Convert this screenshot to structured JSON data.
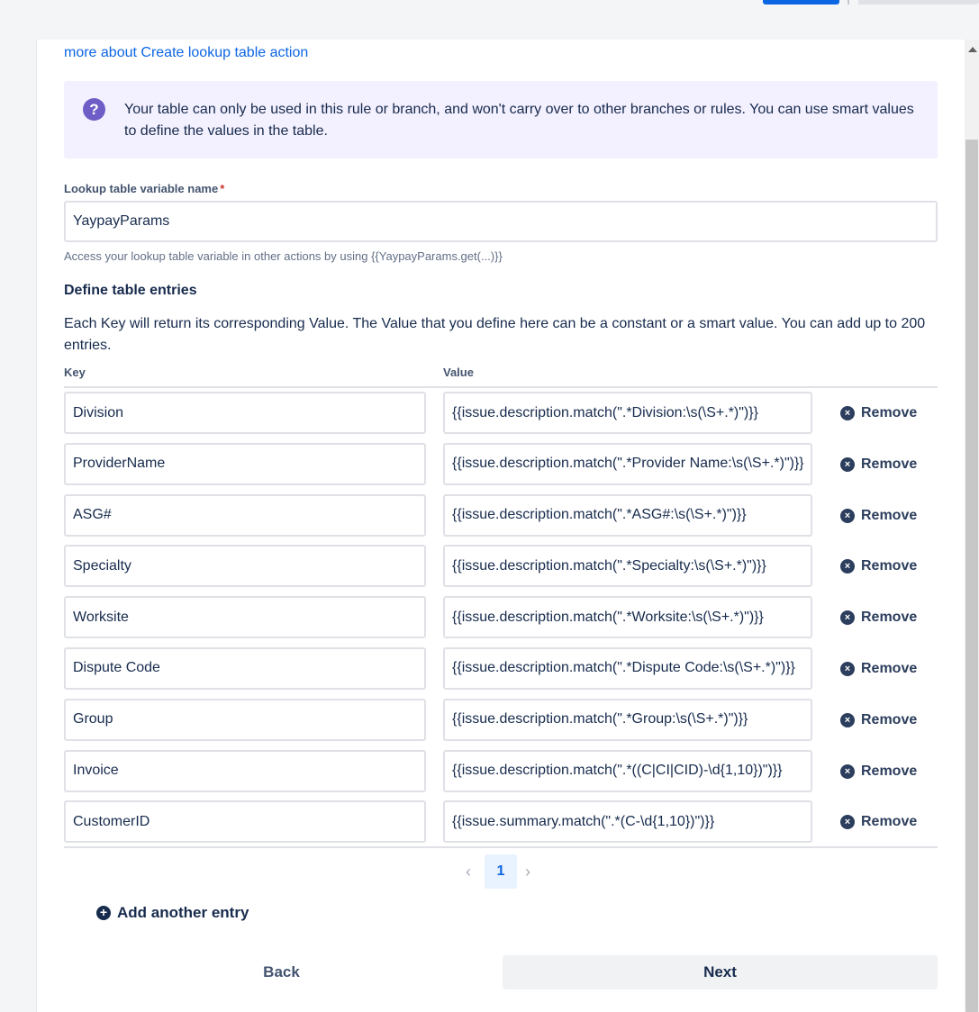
{
  "header": {
    "learn_more_link": "more about Create lookup table action"
  },
  "info_panel": {
    "icon": "question-icon",
    "icon_glyph": "?",
    "text": "Your table can only be used in this rule or branch, and won't carry over to other branches or rules. You can use smart values to define the values in the table."
  },
  "variable": {
    "label": "Lookup table variable name",
    "required_marker": "*",
    "value": "YaypayParams",
    "helper": "Access your lookup table variable in other actions by using {{YaypayParams.get(...)}}"
  },
  "entries_section": {
    "title": "Define table entries",
    "description": "Each Key will return its corresponding Value. The Value that you define here can be a constant or a smart value. You can add up to 200 entries.",
    "key_header": "Key",
    "value_header": "Value",
    "remove_label": "Remove",
    "remove_glyph": "×",
    "rows": [
      {
        "key": "Division",
        "value": "{{issue.description.match(\".*Division:\\s(\\S+.*)\")}}"
      },
      {
        "key": "ProviderName",
        "value": "{{issue.description.match(\".*Provider Name:\\s(\\S+.*)\")}}"
      },
      {
        "key": "ASG#",
        "value": "{{issue.description.match(\".*ASG#:\\s(\\S+.*)\")}}"
      },
      {
        "key": "Specialty",
        "value": "{{issue.description.match(\".*Specialty:\\s(\\S+.*)\")}}"
      },
      {
        "key": "Worksite",
        "value": "{{issue.description.match(\".*Worksite:\\s(\\S+.*)\")}}"
      },
      {
        "key": "Dispute Code",
        "value": "{{issue.description.match(\".*Dispute Code:\\s(\\S+.*)\")}}"
      },
      {
        "key": "Group",
        "value": "{{issue.description.match(\".*Group:\\s(\\S+.*)\")}}"
      },
      {
        "key": "Invoice",
        "value": "{{issue.description.match(\".*((C|CI|CID)-\\d{1,10})\")}}"
      },
      {
        "key": "CustomerID",
        "value": "{{issue.summary.match(\".*(C-\\d{1,10})\")}}"
      }
    ]
  },
  "pagination": {
    "prev_glyph": "‹",
    "current_page": "1",
    "next_glyph": "›"
  },
  "add_entry": {
    "glyph": "+",
    "label": "Add another entry"
  },
  "footer": {
    "back_label": "Back",
    "next_label": "Next"
  }
}
